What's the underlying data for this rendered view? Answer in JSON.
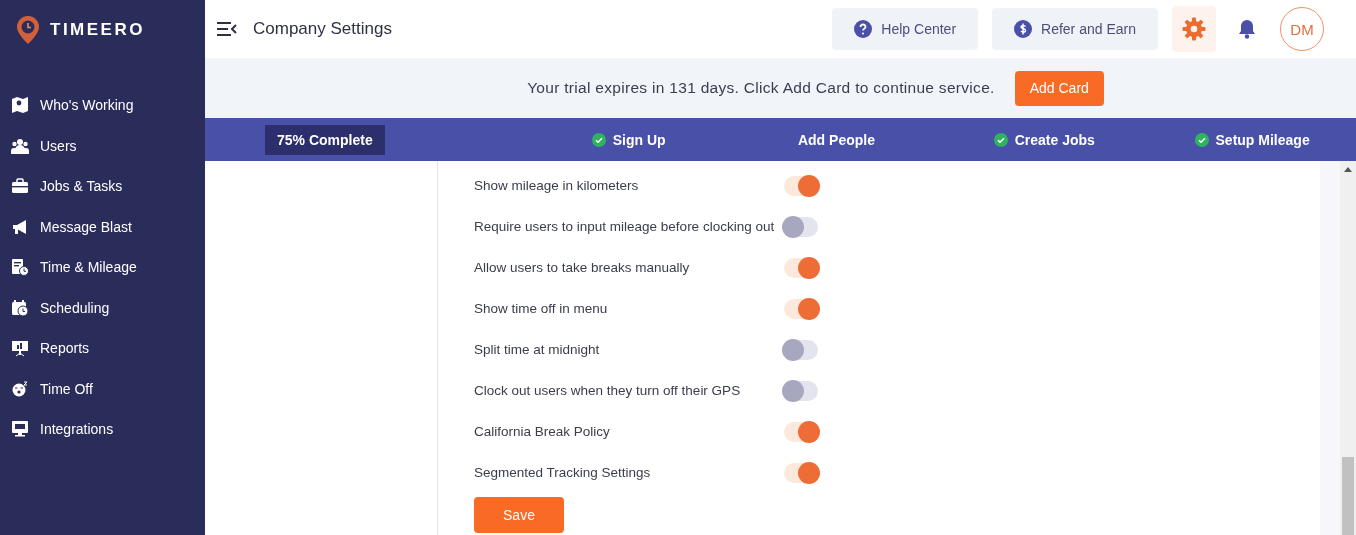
{
  "sidebar": {
    "logo": "TIMEERO",
    "items": [
      {
        "label": "Who's Working"
      },
      {
        "label": "Users"
      },
      {
        "label": "Jobs & Tasks"
      },
      {
        "label": "Message Blast"
      },
      {
        "label": "Time & Mileage"
      },
      {
        "label": "Scheduling"
      },
      {
        "label": "Reports"
      },
      {
        "label": "Time Off"
      },
      {
        "label": "Integrations"
      }
    ]
  },
  "header": {
    "title": "Company Settings",
    "buttons": [
      {
        "label": "Help Center"
      },
      {
        "label": "Refer and Earn"
      }
    ],
    "avatar": "DM"
  },
  "trial_banner": {
    "message": "Your trial expires in 131 days. Click Add Card to continue service.",
    "button": "Add Card"
  },
  "progress": {
    "badge": "75% Complete",
    "steps": [
      {
        "label": "Sign Up",
        "done": true
      },
      {
        "label": "Add People",
        "done": false
      },
      {
        "label": "Create Jobs",
        "done": true
      },
      {
        "label": "Setup Mileage",
        "done": true
      }
    ]
  },
  "settings": [
    {
      "label": "Show mileage in kilometers",
      "on": true
    },
    {
      "label": "Require users to input mileage before clocking out",
      "on": false
    },
    {
      "label": "Allow users to take breaks manually",
      "on": true
    },
    {
      "label": "Show time off in menu",
      "on": true
    },
    {
      "label": "Split time at midnight",
      "on": false
    },
    {
      "label": "Clock out users when they turn off their GPS",
      "on": false
    },
    {
      "label": "California Break Policy",
      "on": true
    },
    {
      "label": "Segmented Tracking Settings",
      "on": true
    }
  ],
  "save_button": "Save"
}
